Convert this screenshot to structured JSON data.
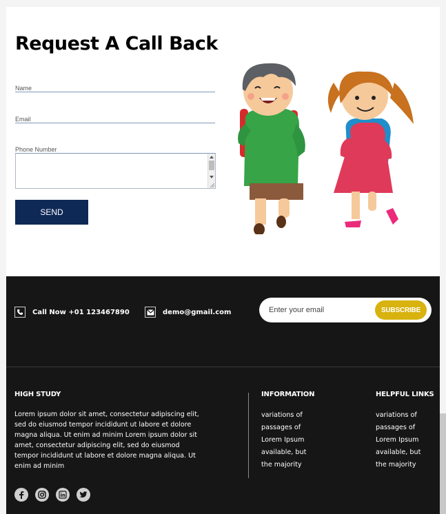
{
  "form": {
    "title": "Request A Call Back",
    "fields": [
      {
        "label": "Name"
      },
      {
        "label": "Email"
      },
      {
        "label": "Phone Number"
      }
    ],
    "send_label": "SEND"
  },
  "footer": {
    "contact": {
      "phone_text": "Call Now +01 123467890",
      "email_text": "demo@gmail.com"
    },
    "subscribe": {
      "placeholder": "Enter your email",
      "button_label": "SUBSCRIBE",
      "button_color": "#d8b20e"
    },
    "columns": {
      "about": {
        "title": "HIGH STUDY",
        "text": "Lorem ipsum dolor sit amet, consectetur adipiscing elit, sed do eiusmod tempor incididunt ut labore et dolore magna aliqua. Ut enim ad minim Lorem ipsum dolor sit amet, consectetur adipiscing elit, sed do eiusmod tempor incididunt ut labore et dolore magna aliqua. Ut enim ad minim"
      },
      "information": {
        "title": "INFORMATION",
        "items": [
          "variations of",
          "passages of",
          "Lorem Ipsum",
          "available, but",
          "the majority"
        ]
      },
      "helpful_links": {
        "title": "HELPFUL LINKS",
        "items": [
          "variations of",
          "passages of",
          "Lorem Ipsum",
          "available, but",
          "the majority"
        ]
      }
    },
    "social": [
      "facebook-icon",
      "instagram-icon",
      "linkedin-icon",
      "twitter-icon"
    ]
  },
  "colors": {
    "primary_button": "#0f2957",
    "footer_bg": "#161616"
  }
}
